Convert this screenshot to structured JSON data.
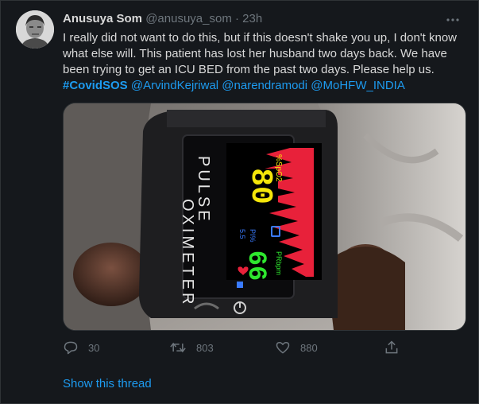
{
  "tweet": {
    "author_name": "Anusuya Som",
    "handle": "@anusuya_som",
    "separator": "·",
    "time": "23h",
    "text_main": "I really did not want to do this, but if this doesn't shake you up, I don't know what else will. This patient has lost her husband two days back. We have been trying to get an ICU BED from the past two days. Please help us.",
    "hashtag": "#CovidSOS",
    "mentions": [
      "@ArvindKejriwal",
      "@narendramodi",
      "@MoHFW_INDIA"
    ]
  },
  "media": {
    "device_label_1": "PULSE",
    "device_label_2": "OXIMETER",
    "spo2_label": "%SpO2",
    "spo2_value": "80",
    "pi_label": "PI%",
    "pi_value": "5.5",
    "pr_label": "PRbpm",
    "pr_value": "66"
  },
  "actions": {
    "reply_count": "30",
    "retweet_count": "803",
    "like_count": "880"
  },
  "footer": {
    "show_thread": "Show this thread"
  },
  "colors": {
    "background": "#15181c",
    "link": "#1d9bf0",
    "muted": "#6e767d",
    "text": "#d9d9d9",
    "spo2": "#f5e60a",
    "pr": "#2ee62e",
    "pleth": "#e8213a"
  }
}
